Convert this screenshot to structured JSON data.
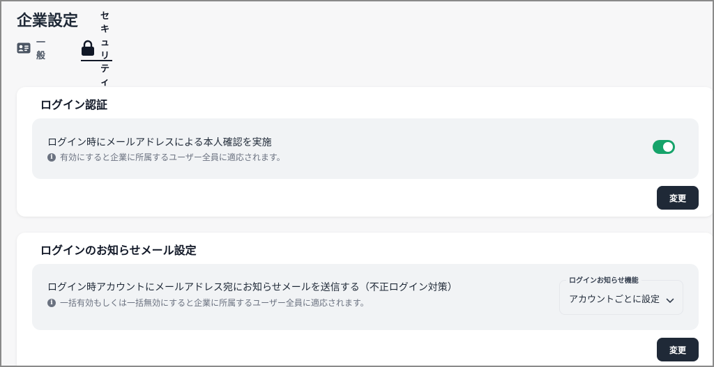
{
  "page": {
    "title": "企業設定"
  },
  "tabs": [
    {
      "label": "一般",
      "icon": "id-card-icon",
      "active": false
    },
    {
      "label": "セキュリティ",
      "icon": "lock-icon",
      "active": true
    }
  ],
  "login_auth": {
    "title": "ログイン認証",
    "setting_label": "ログイン時にメールアドレスによる本人確認を実施",
    "setting_desc": "有効にすると企業に所属するユーザー全員に適応されます。",
    "toggle_on": true,
    "button_label": "変更"
  },
  "login_notify": {
    "title": "ログインのお知らせメール設定",
    "setting_label": "ログイン時アカウントにメールアドレス宛にお知らせメールを送信する（不正ログイン対策）",
    "setting_desc": "一括有効もしくは一括無効にすると企業に所属するユーザー全員に適応されます。",
    "select_caption": "ログインお知らせ機能",
    "select_value": "アカウントごとに設定",
    "button_label": "変更"
  },
  "colors": {
    "primary_dark": "#1f2937",
    "toggle_on": "#16a36a",
    "row_bg": "#f1f3f5"
  }
}
